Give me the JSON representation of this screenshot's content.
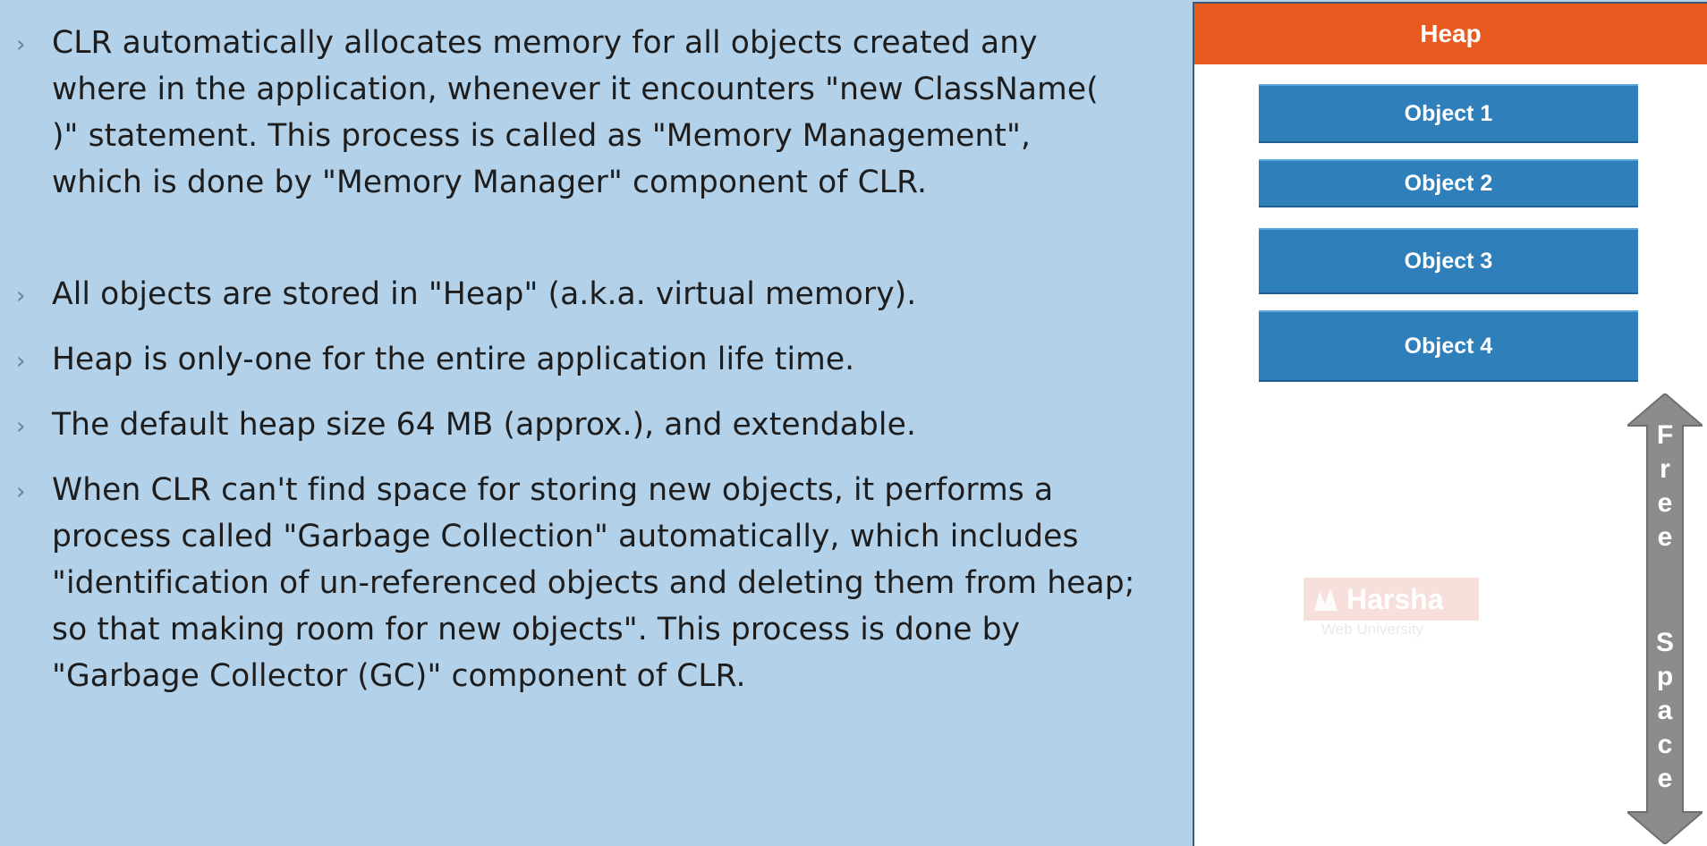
{
  "slide": {
    "bullet_marker": "›",
    "bullets": [
      "CLR automatically allocates memory for all objects created any where in the application, whenever it encounters \"new ClassName( )\" statement. This process is called as \"Memory Management\", which is done by \"Memory Manager\" component of CLR.",
      "All objects are stored in \"Heap\" (a.k.a. virtual memory).",
      "Heap is only-one for the entire application life time.",
      "The default heap size 64 MB (approx.), and extendable.",
      "When CLR can't find space for storing new objects, it performs a process called \"Garbage Collection\" automatically, which includes \"identification of un-referenced objects and deleting them from heap; so that making room for new objects\". This process is done by \"Garbage Collector (GC)\" component of CLR."
    ]
  },
  "heap": {
    "title": "Heap",
    "objects": [
      "Object 1",
      "Object 2",
      "Object 3",
      "Object 4"
    ],
    "free_space_letters": [
      "F",
      "r",
      "e",
      "e",
      "",
      "S",
      "p",
      "a",
      "c",
      "e"
    ]
  },
  "watermark": {
    "name": "Harsha",
    "subtitle": "Web University"
  },
  "colors": {
    "slide_background": "#b3d1e9",
    "heap_title_bg": "#e85a1f",
    "object_bg": "#2f7fba",
    "free_space_arrow": "#8c8c8c"
  }
}
